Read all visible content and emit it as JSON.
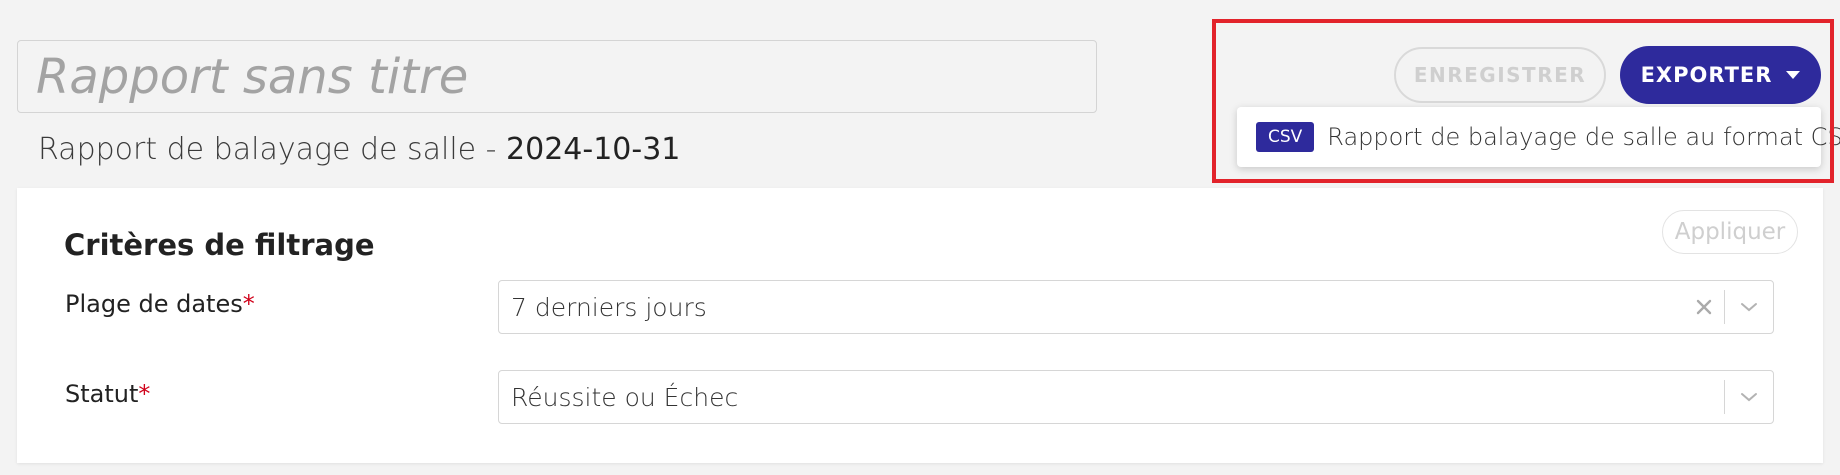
{
  "report": {
    "title_placeholder": "Rapport sans titre",
    "subtitle_prefix": "Rapport de balayage de salle - ",
    "subtitle_date": "2024-10-31"
  },
  "toolbar": {
    "save_label": "ENREGISTRER",
    "export_label": "EXPORTER"
  },
  "export_menu": {
    "items": [
      {
        "badge": "CSV",
        "label": "Rapport de balayage de salle au format CSV"
      }
    ]
  },
  "filters": {
    "title": "Critères de filtrage",
    "apply_label": "Appliquer",
    "fields": [
      {
        "label": "Plage de dates",
        "required_mark": "*",
        "value": "7 derniers jours"
      },
      {
        "label": "Statut",
        "required_mark": "*",
        "value": "Réussite ou Échec"
      }
    ]
  },
  "colors": {
    "primary": "#2e2a9c",
    "highlight": "#e2232b",
    "required": "#d0021b"
  }
}
